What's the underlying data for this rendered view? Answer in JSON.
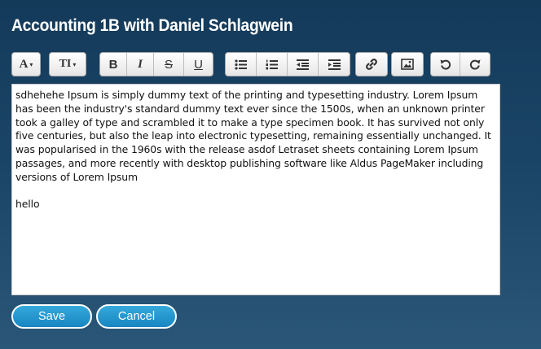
{
  "page": {
    "title": "Accounting 1B with Daniel Schlagwein"
  },
  "toolbar": {
    "font_family_label": "A",
    "font_size_label": "TI",
    "bold_label": "B",
    "italic_label": "I",
    "strike_label": "S",
    "underline_label": "U",
    "icons": [
      "font-family-icon",
      "font-size-icon",
      "bold-icon",
      "italic-icon",
      "strikethrough-icon",
      "underline-icon",
      "bullet-list-icon",
      "numbered-list-icon",
      "outdent-icon",
      "indent-icon",
      "link-icon",
      "image-icon",
      "undo-icon",
      "redo-icon"
    ]
  },
  "editor": {
    "paragraph1": "sdhehehe Ipsum is simply dummy text of the printing and typesetting industry. Lorem Ipsum has been the industry's standard dummy text ever since the 1500s, when an unknown printer took a galley of type and scrambled it to make a type specimen book. It has survived not only five centuries, but also the leap into electronic typesetting, remaining essentially unchanged. It was popularised in the 1960s with the release asdof Letraset sheets containing Lorem Ipsum passages, and more recently with desktop publishing software like Aldus PageMaker including versions of Lorem Ipsum",
    "paragraph2": "hello"
  },
  "actions": {
    "save_label": "Save",
    "cancel_label": "Cancel"
  },
  "colors": {
    "button_blue": "#1e8fc9",
    "background": "#1a4466"
  }
}
